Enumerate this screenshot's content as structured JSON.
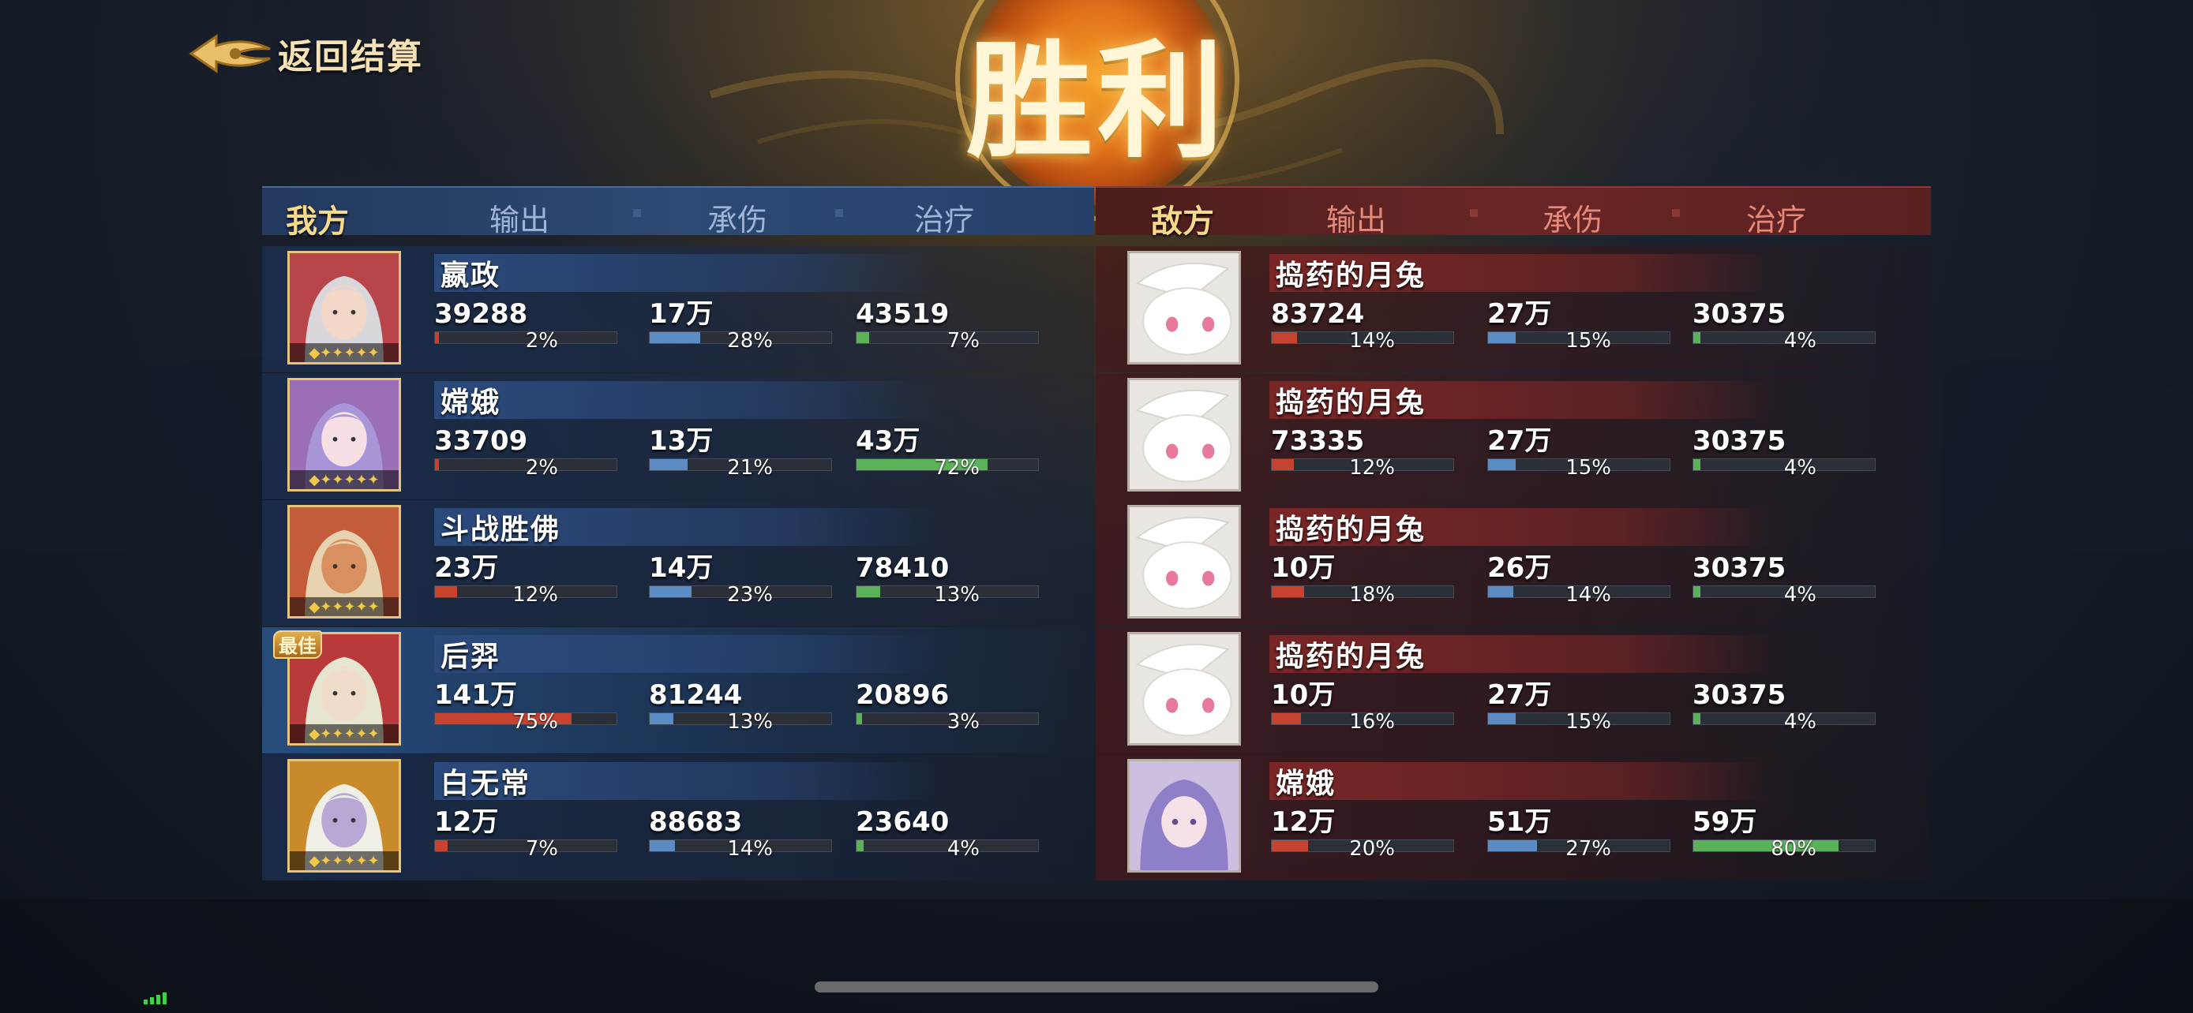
{
  "back": {
    "label": "返回结算"
  },
  "victory": {
    "title": "胜利"
  },
  "headers": {
    "ally_side": "我方",
    "enemy_side": "敌方",
    "col_damage": "输出",
    "col_taken": "承伤",
    "col_heal": "治疗"
  },
  "mvp_label": "最佳",
  "ally": [
    {
      "name": "嬴政",
      "dmg": "39288",
      "dmg_pct": "2%",
      "dmg_frac": 0.02,
      "taken": "17万",
      "taken_pct": "28%",
      "taken_frac": 0.28,
      "heal": "43519",
      "heal_pct": "7%",
      "heal_frac": 0.07,
      "mvp": false
    },
    {
      "name": "嫦娥",
      "dmg": "33709",
      "dmg_pct": "2%",
      "dmg_frac": 0.02,
      "taken": "13万",
      "taken_pct": "21%",
      "taken_frac": 0.21,
      "heal": "43万",
      "heal_pct": "72%",
      "heal_frac": 0.72,
      "mvp": false
    },
    {
      "name": "斗战胜佛",
      "dmg": "23万",
      "dmg_pct": "12%",
      "dmg_frac": 0.12,
      "taken": "14万",
      "taken_pct": "23%",
      "taken_frac": 0.23,
      "heal": "78410",
      "heal_pct": "13%",
      "heal_frac": 0.13,
      "mvp": false
    },
    {
      "name": "后羿",
      "dmg": "141万",
      "dmg_pct": "75%",
      "dmg_frac": 0.75,
      "taken": "81244",
      "taken_pct": "13%",
      "taken_frac": 0.13,
      "heal": "20896",
      "heal_pct": "3%",
      "heal_frac": 0.03,
      "mvp": true
    },
    {
      "name": "白无常",
      "dmg": "12万",
      "dmg_pct": "7%",
      "dmg_frac": 0.07,
      "taken": "88683",
      "taken_pct": "14%",
      "taken_frac": 0.14,
      "heal": "23640",
      "heal_pct": "4%",
      "heal_frac": 0.04,
      "mvp": false
    }
  ],
  "enemy": [
    {
      "name": "捣药的月兔",
      "dmg": "83724",
      "dmg_pct": "14%",
      "dmg_frac": 0.14,
      "taken": "27万",
      "taken_pct": "15%",
      "taken_frac": 0.15,
      "heal": "30375",
      "heal_pct": "4%",
      "heal_frac": 0.04
    },
    {
      "name": "捣药的月兔",
      "dmg": "73335",
      "dmg_pct": "12%",
      "dmg_frac": 0.12,
      "taken": "27万",
      "taken_pct": "15%",
      "taken_frac": 0.15,
      "heal": "30375",
      "heal_pct": "4%",
      "heal_frac": 0.04
    },
    {
      "name": "捣药的月兔",
      "dmg": "10万",
      "dmg_pct": "18%",
      "dmg_frac": 0.18,
      "taken": "26万",
      "taken_pct": "14%",
      "taken_frac": 0.14,
      "heal": "30375",
      "heal_pct": "4%",
      "heal_frac": 0.04
    },
    {
      "name": "捣药的月兔",
      "dmg": "10万",
      "dmg_pct": "16%",
      "dmg_frac": 0.16,
      "taken": "27万",
      "taken_pct": "15%",
      "taken_frac": 0.15,
      "heal": "30375",
      "heal_pct": "4%",
      "heal_frac": 0.04
    },
    {
      "name": "嫦娥",
      "dmg": "12万",
      "dmg_pct": "20%",
      "dmg_frac": 0.2,
      "taken": "51万",
      "taken_pct": "27%",
      "taken_frac": 0.27,
      "heal": "59万",
      "heal_pct": "80%",
      "heal_frac": 0.8
    }
  ]
}
